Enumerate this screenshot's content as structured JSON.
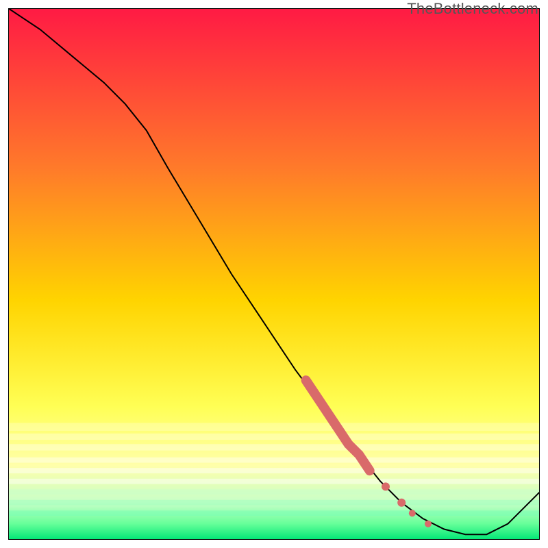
{
  "watermark": "TheBottleneck.com",
  "colors": {
    "gradient_top": "#ff1a44",
    "gradient_mid_upper": "#ff6a2a",
    "gradient_mid": "#ffd400",
    "gradient_yellow_pale": "#ffff9a",
    "gradient_pale_green": "#b7ffb7",
    "gradient_green": "#00e676",
    "line": "#000000",
    "marker": "#d96a6a",
    "border": "#000000"
  },
  "chart_data": {
    "type": "line",
    "title": "",
    "xlabel": "",
    "ylabel": "",
    "xlim": [
      0,
      100
    ],
    "ylim": [
      0,
      100
    ],
    "series": [
      {
        "name": "curve",
        "x": [
          0,
          6,
          12,
          18,
          22,
          26,
          30,
          36,
          42,
          48,
          54,
          60,
          66,
          70,
          74,
          78,
          82,
          86,
          90,
          94,
          100
        ],
        "y": [
          100,
          96,
          91,
          86,
          82,
          77,
          70,
          60,
          50,
          41,
          32,
          24,
          16,
          11,
          7,
          4,
          2,
          1,
          1,
          3,
          9
        ]
      }
    ],
    "markers": {
      "name": "highlight-segment",
      "points": [
        {
          "x": 56,
          "y": 30
        },
        {
          "x": 58,
          "y": 27
        },
        {
          "x": 60,
          "y": 24
        },
        {
          "x": 62,
          "y": 21
        },
        {
          "x": 64,
          "y": 18
        },
        {
          "x": 66,
          "y": 16
        },
        {
          "x": 68,
          "y": 13
        },
        {
          "x": 71,
          "y": 10
        },
        {
          "x": 74,
          "y": 7
        },
        {
          "x": 76,
          "y": 5
        },
        {
          "x": 79,
          "y": 3
        }
      ]
    }
  }
}
